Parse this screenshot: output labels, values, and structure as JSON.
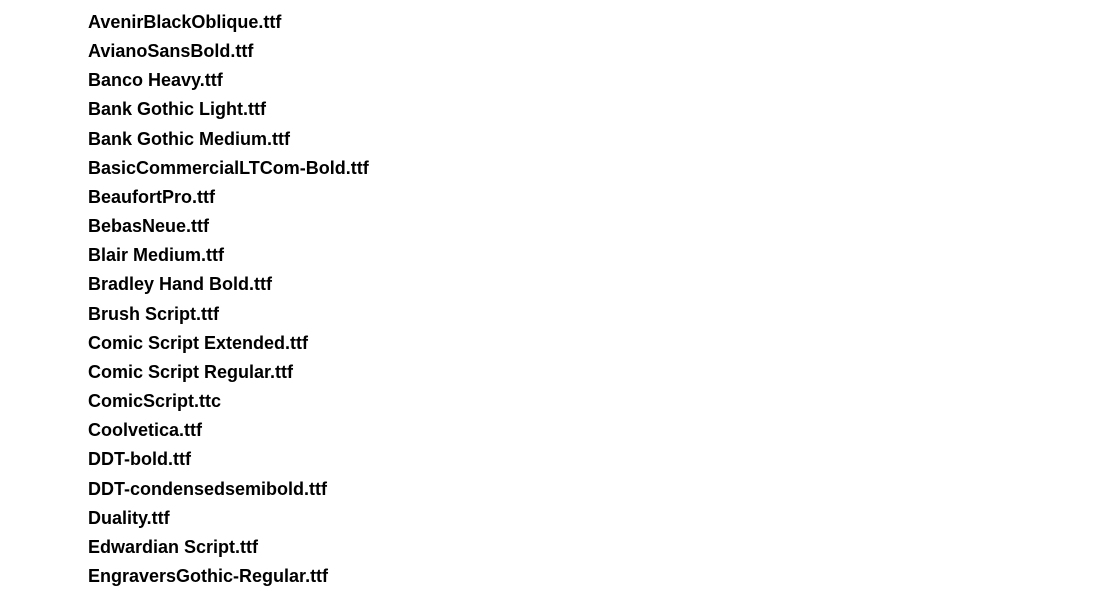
{
  "files": [
    "AvenirBlackOblique.ttf",
    "AvianoSansBold.ttf",
    "Banco Heavy.ttf",
    "Bank Gothic Light.ttf",
    "Bank Gothic Medium.ttf",
    "BasicCommercialLTCom-Bold.ttf",
    "BeaufortPro.ttf",
    "BebasNeue.ttf",
    "Blair Medium.ttf",
    "Bradley Hand Bold.ttf",
    "Brush Script.ttf",
    "Comic Script Extended.ttf",
    "Comic Script Regular.ttf",
    "ComicScript.ttc",
    "Coolvetica.ttf",
    "DDT-bold.ttf",
    "DDT-condensedsemibold.ttf",
    "Duality.ttf",
    "Edwardian Script.ttf",
    "EngraversGothic-Regular.ttf"
  ]
}
